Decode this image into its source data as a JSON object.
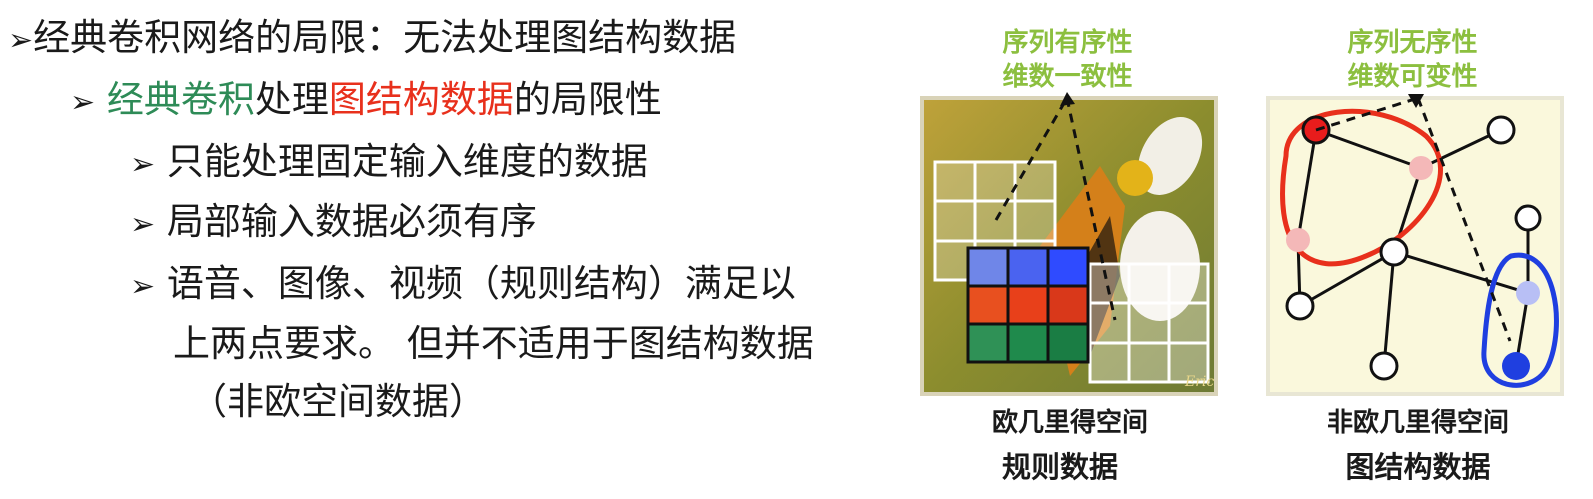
{
  "text": {
    "line1": "经典卷积网络的局限：无法处理图结构数据",
    "line2_green": "经典卷积",
    "line2_mid": "处理",
    "line2_red": "图结构数据",
    "line2_end": "的局限性",
    "bullet1": "只能处理固定输入维度的数据",
    "bullet2": "局部输入数据必须有序",
    "bullet3_a": "语音、图像、视频（规则结构）满足以",
    "bullet3_b": "上两点要求。 但并不适用于图结构数据",
    "bullet3_c": "（非欧空间数据）",
    "arrow": "➢"
  },
  "left_panel": {
    "top1": "序列有序性",
    "top2": "维数一致性",
    "cap1": "欧几里得空间",
    "cap2": "规则数据",
    "watermark": "Eric"
  },
  "right_panel": {
    "top1": "序列无序性",
    "top2": "维数可变性",
    "cap1": "非欧几里得空间",
    "cap2": "图结构数据"
  },
  "colors": {
    "green_text": "#2e8b57",
    "red_text": "#e8301c",
    "label_green": "#8cbf3f",
    "grid_blue": "#2f5bff",
    "grid_red": "#e8401a",
    "grid_green": "#1f8a4c"
  }
}
